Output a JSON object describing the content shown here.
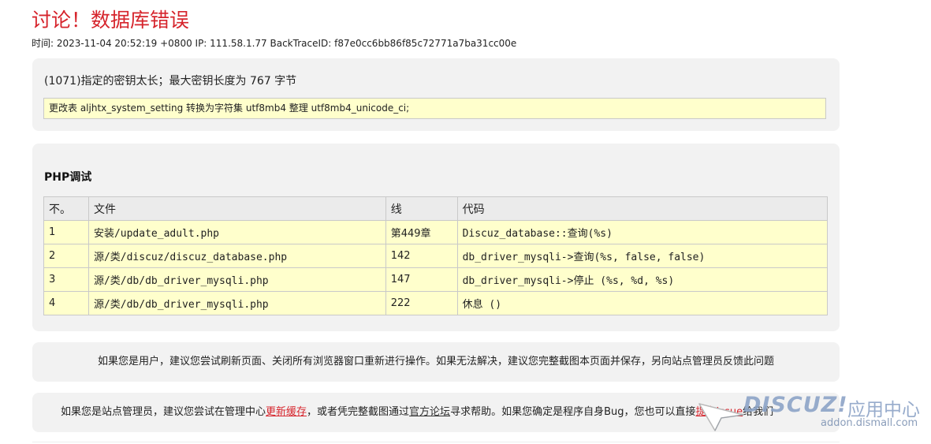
{
  "page": {
    "title": "讨论！数据库错误",
    "meta": "时间: 2023-11-04 20:52:19 +0800 IP: 111.58.1.77 BackTraceID: f87e0cc6bb86f85c72771a7ba31cc00e"
  },
  "error": {
    "message": "(1071)指定的密钥太长；最大密钥长度为 767 字节",
    "sql": "更改表 aljhtx_system_setting 转换为字符集 utf8mb4 整理 utf8mb4_unicode_ci;"
  },
  "debug": {
    "title": "PHP调试",
    "headers": [
      "不。",
      "文件",
      "线",
      "代码"
    ],
    "rows": [
      {
        "no": "1",
        "file": "安装/update_adult.php",
        "line": "第449章",
        "code": "Discuz_database::查询(%s)"
      },
      {
        "no": "2",
        "file": "源/类/discuz/discuz_database.php",
        "line": "142",
        "code": "db_driver_mysqli->查询(%s, false, false)"
      },
      {
        "no": "3",
        "file": "源/类/db/db_driver_mysqli.php",
        "line": "147",
        "code": "db_driver_mysqli->停止 (%s, %d, %s)"
      },
      {
        "no": "4",
        "file": "源/类/db/db_driver_mysqli.php",
        "line": "222",
        "code": "休息 ()"
      }
    ]
  },
  "user_tip": "如果您是用户，建议您尝试刷新页面、关闭所有浏览器窗口重新进行操作。如果无法解决，建议您完整截图本页面并保存，另向站点管理员反馈此问题",
  "admin_tip": {
    "part1": "如果您是站点管理员，建议您尝试在管理中心",
    "link_refresh": "更新缓存",
    "part2": "，或者凭完整截图通过",
    "link_forum": "官方论坛",
    "part3": "寻求帮助。如果您确定是程序自身Bug，您也可以直接",
    "link_issue": "提交Issue",
    "part4": "给我们"
  },
  "watermark": {
    "brand": "DISCUZ!",
    "cn": "应用中心",
    "url": "addon.dismall.com"
  },
  "colors": {
    "title_red": "#d6242c",
    "panel_bg": "#f2f2f2",
    "highlight_yellow": "#ffffcc"
  }
}
